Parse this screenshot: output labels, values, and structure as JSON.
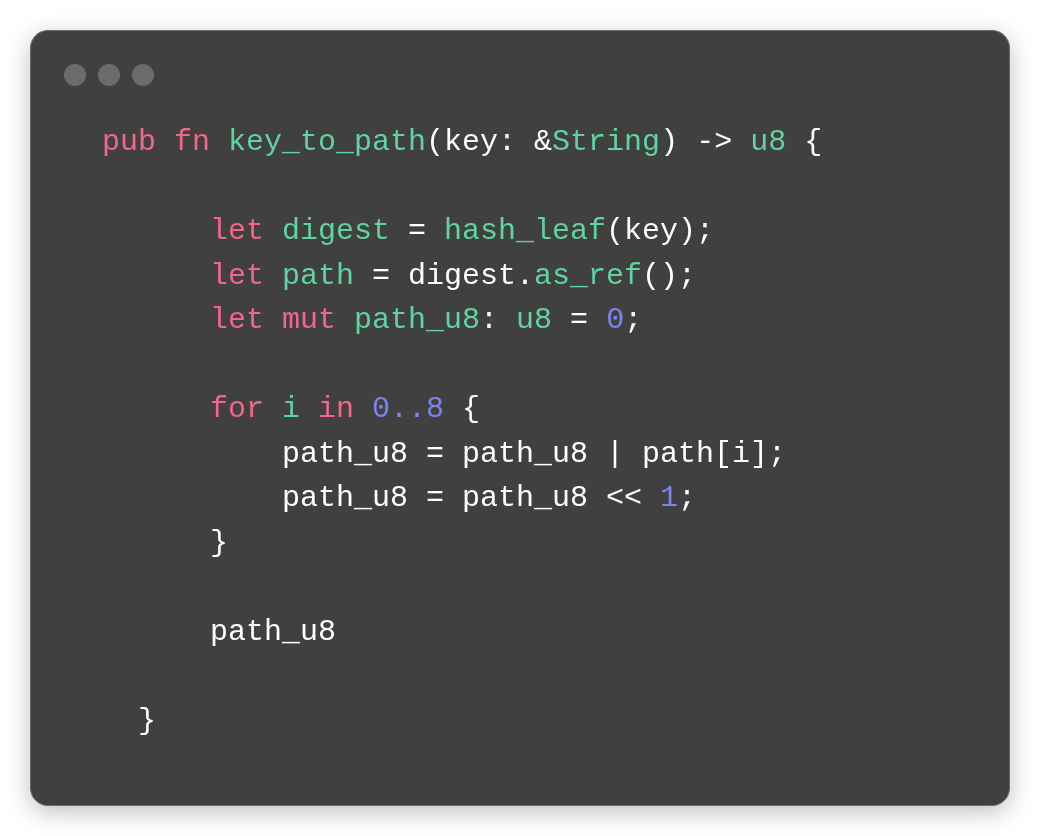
{
  "code": [
    {
      "kind": "code",
      "tokens": [
        {
          "kind": "keyword",
          "text": "pub fn "
        },
        {
          "kind": "function",
          "text": "key_to_path"
        },
        {
          "kind": "plain",
          "text": "(key: &"
        },
        {
          "kind": "type",
          "text": "String"
        },
        {
          "kind": "plain",
          "text": ") -> "
        },
        {
          "kind": "type",
          "text": "u8"
        },
        {
          "kind": "plain",
          "text": " {"
        }
      ],
      "children": [
        {
          "kind": "blank"
        },
        {
          "kind": "code",
          "tokens": [
            {
              "kind": "keyword",
              "text": "let "
            },
            {
              "kind": "function",
              "text": "digest"
            },
            {
              "kind": "plain",
              "text": " = "
            },
            {
              "kind": "function",
              "text": "hash_leaf"
            },
            {
              "kind": "plain",
              "text": "(key);"
            }
          ]
        },
        {
          "kind": "code",
          "tokens": [
            {
              "kind": "keyword",
              "text": "let "
            },
            {
              "kind": "function",
              "text": "path"
            },
            {
              "kind": "plain",
              "text": " = digest."
            },
            {
              "kind": "function",
              "text": "as_ref"
            },
            {
              "kind": "plain",
              "text": "();"
            }
          ]
        },
        {
          "kind": "code",
          "tokens": [
            {
              "kind": "keyword",
              "text": "let mut "
            },
            {
              "kind": "function",
              "text": "path_u8"
            },
            {
              "kind": "plain",
              "text": ": "
            },
            {
              "kind": "type",
              "text": "u8"
            },
            {
              "kind": "plain",
              "text": " = "
            },
            {
              "kind": "number",
              "text": "0"
            },
            {
              "kind": "plain",
              "text": ";"
            }
          ]
        },
        {
          "kind": "blank"
        },
        {
          "kind": "code",
          "tokens": [
            {
              "kind": "keyword",
              "text": "for "
            },
            {
              "kind": "function",
              "text": "i "
            },
            {
              "kind": "keyword",
              "text": "in "
            },
            {
              "kind": "number",
              "text": "0..8"
            },
            {
              "kind": "plain",
              "text": " {"
            }
          ],
          "children": [
            {
              "kind": "code",
              "tokens": [
                {
                  "kind": "plain",
                  "text": "path_u8 = path_u8 | path[i];"
                }
              ]
            },
            {
              "kind": "code",
              "tokens": [
                {
                  "kind": "plain",
                  "text": "path_u8 = path_u8 << "
                },
                {
                  "kind": "number",
                  "text": "1"
                },
                {
                  "kind": "plain",
                  "text": ";"
                }
              ]
            }
          ]
        },
        {
          "kind": "code",
          "tokens": [
            {
              "kind": "plain",
              "text": "}"
            }
          ]
        },
        {
          "kind": "blank"
        },
        {
          "kind": "code",
          "tokens": [
            {
              "kind": "plain",
              "text": "path_u8"
            }
          ]
        },
        {
          "kind": "blank"
        }
      ]
    },
    {
      "kind": "code",
      "tokens": [
        {
          "kind": "plain",
          "text": "  }"
        }
      ]
    }
  ]
}
